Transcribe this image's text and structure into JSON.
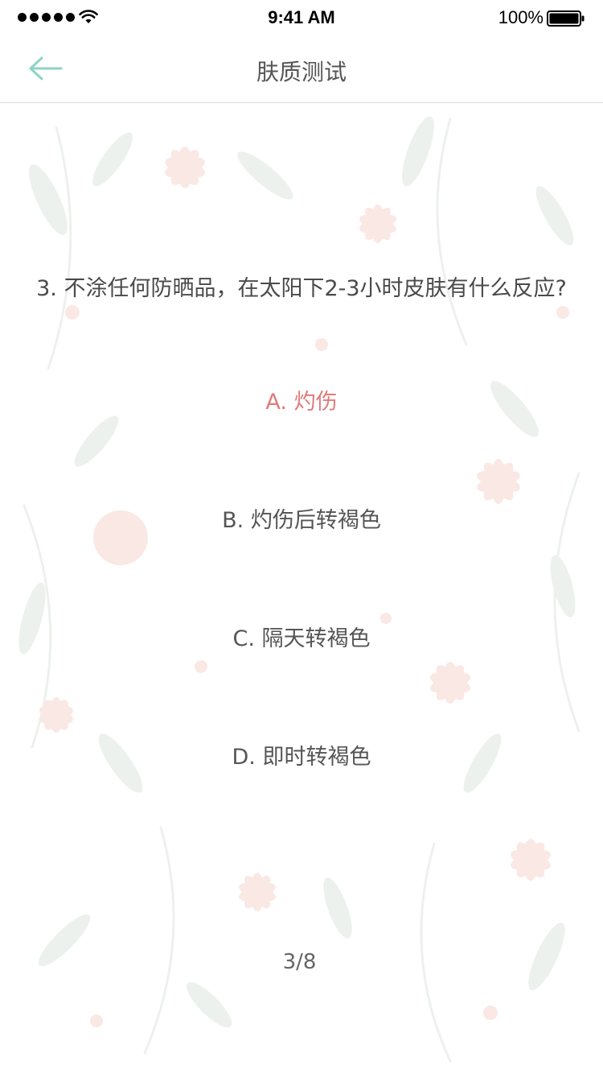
{
  "status_bar": {
    "time": "9:41 AM",
    "battery_percent": "100%",
    "battery_level": 1.0,
    "signal_icon": "signal-dots-icon",
    "wifi_icon": "wifi-icon",
    "battery_icon": "battery-icon"
  },
  "nav": {
    "title": "肤质测试",
    "back_icon": "arrow-left-icon",
    "accent_color": "#8fd3c4"
  },
  "quiz": {
    "question": "3. 不涂任何防晒品，在太阳下2-3小时皮肤有什么反应?",
    "options": [
      {
        "label": "A. 灼伤",
        "selected": true
      },
      {
        "label": "B. 灼伤后转褐色",
        "selected": false
      },
      {
        "label": "C. 隔天转褐色",
        "selected": false
      },
      {
        "label": "D. 即时转褐色",
        "selected": false
      }
    ],
    "selected_color": "#e07b7b",
    "progress_text": "3/8",
    "current": 3,
    "total": 8
  },
  "background": {
    "pattern_icon": "floral-pattern-icon",
    "colors": [
      "#f6d6d0",
      "#dfe6df"
    ]
  }
}
